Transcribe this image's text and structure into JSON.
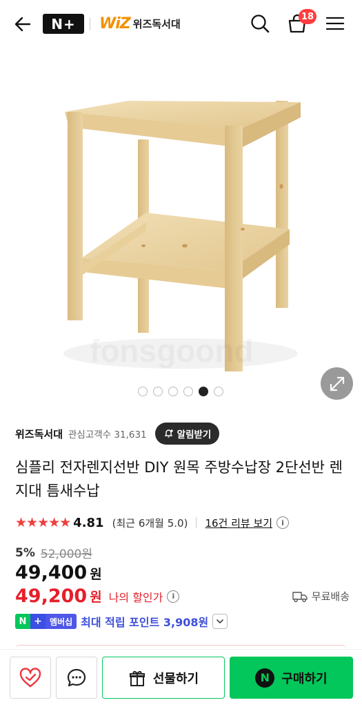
{
  "header": {
    "back_icon": "arrow-left-icon",
    "platform_logo": "N+",
    "store_logo_mark": "WiZ",
    "store_logo_name": "위즈독서대",
    "search_icon": "search-icon",
    "cart_icon": "shopping-bag-icon",
    "cart_count": "18",
    "menu_icon": "hamburger-menu-icon"
  },
  "gallery": {
    "watermark": "fonsgoond",
    "slides_total": 6,
    "active_slide": 5,
    "expand_icon": "expand-arrows-icon"
  },
  "seller": {
    "name": "위즈독서대",
    "fans": "관심고객수 31,631",
    "alert_label": "알림받기",
    "alert_icon": "bell-plus-icon"
  },
  "product": {
    "title": "심플리 전자렌지선반 DIY 원목 주방수납장 2단선반 렌지대 틈새수납"
  },
  "rating": {
    "stars": "★★★★★",
    "score": "4.81",
    "recent": "(최근 6개월 5.0)",
    "review_link": "16건 리뷰 보기",
    "info_icon_char": "i"
  },
  "price": {
    "discount_rate": "5%",
    "original": "52,000원",
    "sale": "49,400",
    "sale_unit": "원",
    "my_price": "49,200",
    "my_price_unit": "원",
    "my_price_label": "나의 할인가",
    "shipping": "무료배송",
    "shipping_icon": "truck-icon"
  },
  "points": {
    "badge_n": "N",
    "badge_plus": "+",
    "badge_member": "멤버십",
    "text": "최대 적립 포인트 3,908원",
    "chevron_icon": "chevron-down-icon"
  },
  "colors": {
    "naver_green": "#03c75a",
    "price_red": "#e5202b",
    "point_blue": "#3d4fd8",
    "star_red": "#ef3e3e"
  },
  "bottom_bar": {
    "wish_icon": "heart-check-icon",
    "talk_icon": "chat-bubble-icon",
    "gift_icon": "gift-icon",
    "gift_label": "선물하기",
    "buy_icon_char": "N",
    "buy_label": "구매하기"
  }
}
